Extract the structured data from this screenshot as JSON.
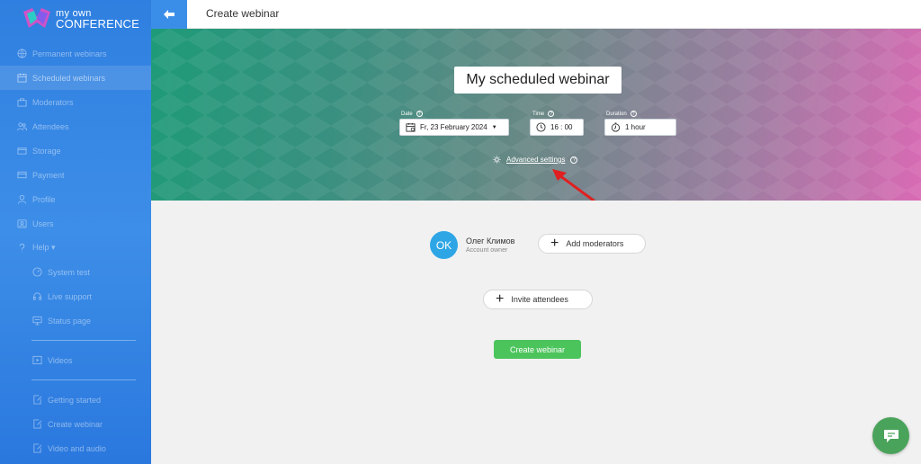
{
  "brand": {
    "line1": "my own",
    "line2": "CONFERENCE"
  },
  "sidebar": {
    "items": [
      {
        "label": "Permanent webinars",
        "icon": "globe-icon"
      },
      {
        "label": "Scheduled webinars",
        "icon": "calendar-icon",
        "active": true
      },
      {
        "label": "Moderators",
        "icon": "briefcase-icon"
      },
      {
        "label": "Attendees",
        "icon": "users-icon"
      },
      {
        "label": "Storage",
        "icon": "storage-icon"
      },
      {
        "label": "Payment",
        "icon": "credit-card-icon"
      },
      {
        "label": "Profile",
        "icon": "user-icon"
      },
      {
        "label": "Users",
        "icon": "user-group-icon"
      },
      {
        "label": "Help ▾",
        "icon": "help-icon"
      }
    ],
    "help_items": [
      {
        "label": "System test",
        "icon": "gauge-icon"
      },
      {
        "label": "Live support",
        "icon": "headset-icon"
      },
      {
        "label": "Status page",
        "icon": "monitor-icon"
      }
    ],
    "media_items": [
      {
        "label": "Videos",
        "icon": "video-icon"
      }
    ],
    "guide_items": [
      {
        "label": "Getting started",
        "icon": "doc-edit-icon"
      },
      {
        "label": "Create webinar",
        "icon": "doc-edit-icon"
      },
      {
        "label": "Video and audio",
        "icon": "doc-edit-icon"
      }
    ]
  },
  "header": {
    "title": "Create webinar"
  },
  "webinar": {
    "title": "My scheduled webinar",
    "date_label": "Date",
    "date_value": "Fr, 23 February 2024",
    "time_label": "Time",
    "time_value": "16 : 00",
    "duration_label": "Duration",
    "duration_value": "1 hour",
    "advanced_settings": "Advanced settings",
    "help_glyph": "?"
  },
  "owner": {
    "initials": "OK",
    "name": "Олег Климов",
    "role": "Account owner"
  },
  "actions": {
    "add_moderators": "Add moderators",
    "invite_attendees": "Invite attendees",
    "create_webinar": "Create webinar"
  },
  "colors": {
    "sidebar": "#2f7fe0",
    "accent_green": "#4cc45c",
    "avatar": "#2ea6e6",
    "annotation_arrow": "#e02020",
    "chat": "#4aa35a"
  }
}
